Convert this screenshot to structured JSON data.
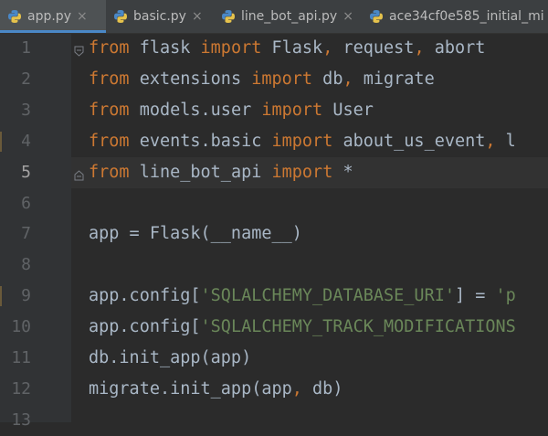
{
  "tabs": [
    {
      "label": "app.py",
      "icon": "python-file-icon",
      "active": true
    },
    {
      "label": "basic.py",
      "icon": "python-file-icon",
      "active": false
    },
    {
      "label": "line_bot_api.py",
      "icon": "python-file-icon",
      "active": false
    },
    {
      "label": "ace34cf0e585_initial_mi",
      "icon": "python-file-icon",
      "active": false
    }
  ],
  "close_glyph": "×",
  "current_line": 5,
  "lines": [
    {
      "num": "1",
      "segments": [
        [
          "kw",
          "from"
        ],
        [
          "t",
          " flask "
        ],
        [
          "kw",
          "import"
        ],
        [
          "t",
          " Flask"
        ],
        [
          "kw",
          ","
        ],
        [
          "t",
          " request"
        ],
        [
          "kw",
          ","
        ],
        [
          "t",
          " abort"
        ]
      ]
    },
    {
      "num": "2",
      "segments": [
        [
          "kw",
          "from"
        ],
        [
          "t",
          " extensions "
        ],
        [
          "kw",
          "import"
        ],
        [
          "t",
          " db"
        ],
        [
          "kw",
          ","
        ],
        [
          "t",
          " migrate"
        ]
      ]
    },
    {
      "num": "3",
      "segments": [
        [
          "kw",
          "from"
        ],
        [
          "t",
          " models.user "
        ],
        [
          "kw",
          "import"
        ],
        [
          "t",
          " User"
        ]
      ]
    },
    {
      "num": "4",
      "segments": [
        [
          "kw",
          "from"
        ],
        [
          "t",
          " events.basic "
        ],
        [
          "kw",
          "import"
        ],
        [
          "t",
          " about_us_event"
        ],
        [
          "kw",
          ","
        ],
        [
          "t",
          " l"
        ]
      ]
    },
    {
      "num": "5",
      "segments": [
        [
          "kw",
          "from"
        ],
        [
          "t",
          " line_bot_api "
        ],
        [
          "kw",
          "import"
        ],
        [
          "t",
          " *"
        ]
      ]
    },
    {
      "num": "6",
      "segments": []
    },
    {
      "num": "7",
      "segments": [
        [
          "t",
          "app = Flask(__name__)"
        ]
      ]
    },
    {
      "num": "8",
      "segments": []
    },
    {
      "num": "9",
      "segments": [
        [
          "t",
          "app.config["
        ],
        [
          "str",
          "'SQLALCHEMY_DATABASE_URI'"
        ],
        [
          "t",
          "] = "
        ],
        [
          "str",
          "'p"
        ]
      ]
    },
    {
      "num": "10",
      "segments": [
        [
          "t",
          "app.config["
        ],
        [
          "str",
          "'SQLALCHEMY_TRACK_MODIFICATIONS"
        ]
      ]
    },
    {
      "num": "11",
      "segments": [
        [
          "t",
          "db.init_app(app)"
        ]
      ]
    },
    {
      "num": "12",
      "segments": [
        [
          "t",
          "migrate.init_app(app"
        ],
        [
          "kw",
          ","
        ],
        [
          "t",
          " db)"
        ]
      ]
    },
    {
      "num": "13",
      "segments": []
    }
  ],
  "colors": {
    "keyword": "#cc7832",
    "string": "#6a8759",
    "text": "#a9b7c6",
    "background": "#2b2b2b",
    "gutter": "#313335",
    "tab_accent": "#4a88c7"
  }
}
